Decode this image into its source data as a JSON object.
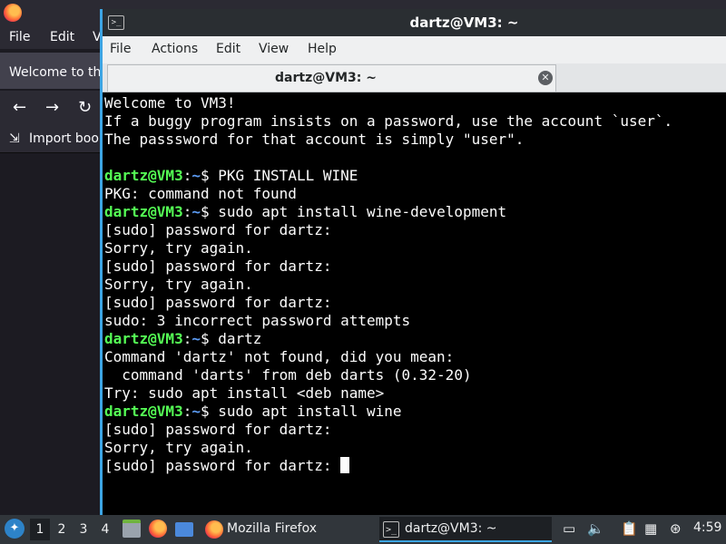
{
  "firefox": {
    "menus": [
      "File",
      "Edit",
      "V"
    ],
    "tab_title": "Welcome to the",
    "bookmark_label": "Import book"
  },
  "terminal": {
    "window_title": "dartz@VM3: ~",
    "menus": [
      "File",
      "Actions",
      "Edit",
      "View",
      "Help"
    ],
    "tab_title": "dartz@VM3: ~",
    "prompt": {
      "user_host": "dartz@VM3",
      "sep": ":",
      "path": "~",
      "symbol": "$ "
    },
    "lines": [
      "Welcome to VM3!",
      "If a buggy program insists on a password, use the account `user`.",
      "The passsword for that account is simply \"user\".",
      "",
      "PKG INSTALL WINE",
      "PKG: command not found",
      "sudo apt install wine-development",
      "[sudo] password for dartz:",
      "Sorry, try again.",
      "[sudo] password for dartz:",
      "Sorry, try again.",
      "[sudo] password for dartz:",
      "sudo: 3 incorrect password attempts",
      "dartz",
      "Command 'dartz' not found, did you mean:",
      "  command 'darts' from deb darts (0.32-20)",
      "Try: sudo apt install <deb name>",
      "sudo apt install wine",
      "[sudo] password for dartz:",
      "Sorry, try again.",
      "[sudo] password for dartz: "
    ]
  },
  "taskbar": {
    "workspaces": [
      "1",
      "2",
      "3",
      "4"
    ],
    "active_workspace": "1",
    "tasks": [
      "Mozilla Firefox",
      "dartz@VM3: ~"
    ],
    "clock": "4:59"
  },
  "colors": {
    "terminal_bg": "#000000",
    "terminal_fg": "#fcfcfc",
    "prompt_user": "#55ff55",
    "prompt_path": "#5c9cf5",
    "accent": "#3da5e4"
  }
}
